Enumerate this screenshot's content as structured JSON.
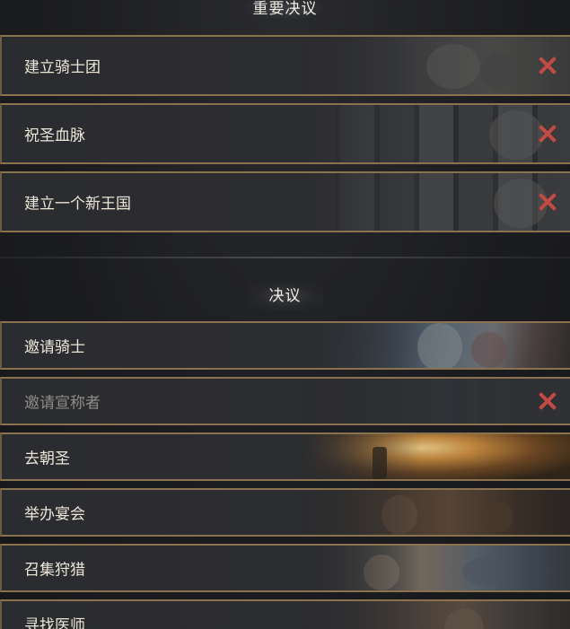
{
  "sections": {
    "important": {
      "title": "重要决议",
      "items": [
        {
          "label": "建立骑士团",
          "blocked": true,
          "art": "knights"
        },
        {
          "label": "祝圣血脉",
          "blocked": true,
          "art": "stone"
        },
        {
          "label": "建立一个新王国",
          "blocked": true,
          "art": "stone"
        }
      ]
    },
    "decisions": {
      "title": "决议",
      "items": [
        {
          "label": "邀请骑士",
          "blocked": false,
          "art": "battle"
        },
        {
          "label": "邀请宣称者",
          "blocked": true,
          "art": "dark"
        },
        {
          "label": "去朝圣",
          "blocked": false,
          "art": "pilgrim"
        },
        {
          "label": "举办宴会",
          "blocked": false,
          "art": "feast"
        },
        {
          "label": "召集狩猎",
          "blocked": false,
          "art": "hunt"
        },
        {
          "label": "寻找医师",
          "blocked": false,
          "art": "physician"
        }
      ]
    }
  },
  "icons": {
    "blocked": "close-x-icon"
  },
  "colors": {
    "row_border": "#8a7150",
    "blocked_x": "#c44a44",
    "label": "#ece6da",
    "label_disabled": "#8d8c88"
  }
}
